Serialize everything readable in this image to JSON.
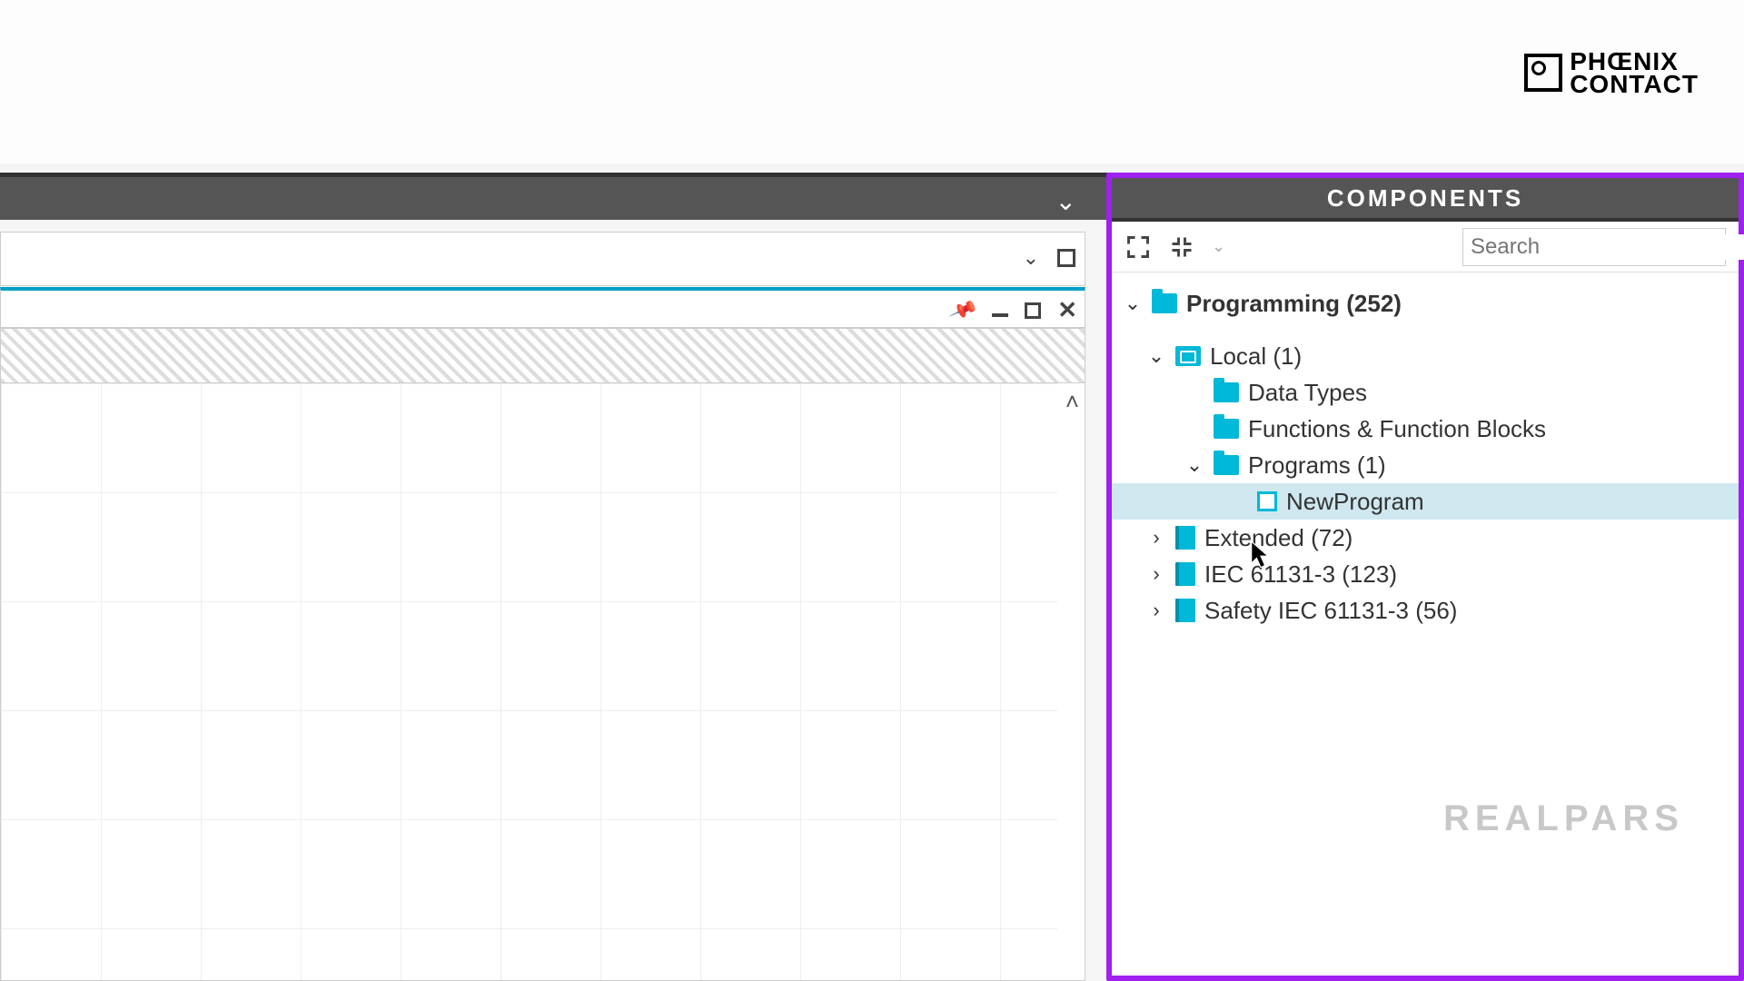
{
  "brand": {
    "line1": "PHŒNIX",
    "line2": "CONTACT"
  },
  "components_panel": {
    "title": "COMPONENTS",
    "search_placeholder": "Search"
  },
  "tree": {
    "root": {
      "label": "Programming (252)"
    },
    "local": {
      "label": "Local (1)"
    },
    "datatypes": {
      "label": "Data Types"
    },
    "funcs": {
      "label": "Functions & Function Blocks"
    },
    "programs": {
      "label": "Programs (1)"
    },
    "newprogram": {
      "label": "NewProgram"
    },
    "extended": {
      "label": "Extended (72)"
    },
    "iec": {
      "label": "IEC 61131-3 (123)"
    },
    "safety": {
      "label": "Safety IEC 61131-3 (56)"
    }
  },
  "watermark": "REALPARS"
}
